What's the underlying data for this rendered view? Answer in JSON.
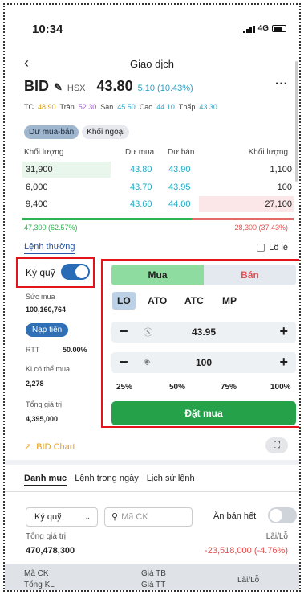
{
  "status": {
    "time": "10:34",
    "network": "4G"
  },
  "header": {
    "back": "‹",
    "title": "Giao dịch",
    "more": "···"
  },
  "stock": {
    "symbol": "BID",
    "exchange": "HSX",
    "price": "43.80",
    "change": "5.10 (10.43%)"
  },
  "refs": [
    {
      "label": "TC",
      "value": "48.90"
    },
    {
      "label": "Trần",
      "value": "52.30"
    },
    {
      "label": "Sàn",
      "value": "45.50"
    },
    {
      "label": "Cao",
      "value": "44.10"
    },
    {
      "label": "Thấp",
      "value": "43.30"
    }
  ],
  "chips": [
    "Dư mua-bán",
    "Khối ngoại"
  ],
  "orderbook": {
    "headers": [
      "Khối lượng",
      "Dư mua",
      "Dư bán",
      "Khối lượng"
    ],
    "rows": [
      {
        "buy_qty": "31,900",
        "buy_price": "43.80",
        "sell_price": "43.90",
        "sell_qty": "1,100"
      },
      {
        "buy_qty": "6,000",
        "buy_price": "43.70",
        "sell_price": "43.95",
        "sell_qty": "100"
      },
      {
        "buy_qty": "9,400",
        "buy_price": "43.60",
        "sell_price": "44.00",
        "sell_qty": "27,100"
      }
    ],
    "buy_total": "47,300 (62.57%)",
    "sell_total": "28,300 (37.43%)",
    "buy_ratio": 0.6257
  },
  "order_mode": {
    "label": "Lệnh thường",
    "odd_lot": "Lô lẻ"
  },
  "account": {
    "margin_label": "Ký quỹ",
    "margin_on": true,
    "purchasing_power_label": "Sức mua",
    "purchasing_power": "100,160,764",
    "deposit_button": "Nạp tiền",
    "rtt_label": "RTT",
    "rtt_value": "50.00%",
    "max_buy_label": "Kl có thể mua",
    "max_buy": "2,278",
    "total_value_label": "Tổng giá trị",
    "total_value": "4,395,000"
  },
  "order": {
    "buy_tab": "Mua",
    "sell_tab": "Bán",
    "types": [
      "LO",
      "ATO",
      "ATC",
      "MP"
    ],
    "selected_type": "LO",
    "price": "43.95",
    "quantity": "100",
    "percents": [
      "25%",
      "50%",
      "75%",
      "100%"
    ],
    "submit": "Đặt mua"
  },
  "chart_link": "BID Chart",
  "tabs": [
    "Danh mục",
    "Lệnh trong ngày",
    "Lịch sử lệnh"
  ],
  "portfolio": {
    "account_select": "Ký quỹ",
    "search_placeholder": "Mã CK",
    "hide_sold_label": "Ẩn bán hết",
    "total_label": "Tổng giá trị",
    "total_value": "470,478,300",
    "pl_label": "Lãi/Lỗ",
    "pl_value": "-23,518,000 (-4.76%)",
    "columns": {
      "code": "Mã CK",
      "vol": "Tổng KL",
      "avg_price": "Giá TB",
      "cur_price": "Giá TT",
      "pl": "Lãi/Lỗ"
    }
  },
  "colors": {
    "accent": "#2a6bb5",
    "buy": "#25a14a",
    "sell": "#e05252",
    "up": "#21a9c6",
    "highlight": "#e3141b"
  }
}
